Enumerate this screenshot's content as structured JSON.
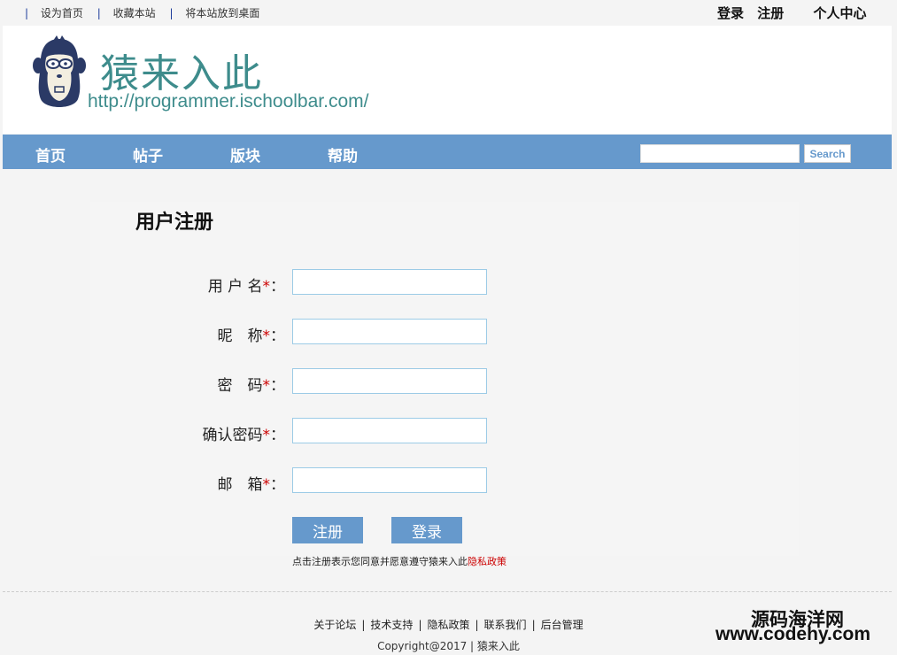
{
  "topbar": {
    "sep": "|",
    "links": [
      "设为首页",
      "收藏本站",
      "将本站放到桌面"
    ],
    "login": "登录",
    "register": "注册",
    "user_center": "个人中心"
  },
  "header": {
    "title": "猿来入此",
    "url": "http://programmer.ischoolbar.com/"
  },
  "nav": {
    "items": [
      "首页",
      "帖子",
      "版块",
      "帮助"
    ],
    "search_value": "",
    "search_button": "Search"
  },
  "form": {
    "title": "用户注册",
    "fields": [
      {
        "label": "用 户 名",
        "star": "*",
        "colon": "：",
        "value": ""
      },
      {
        "label": "昵　称",
        "star": "*",
        "colon": "：",
        "value": ""
      },
      {
        "label": "密　码",
        "star": "*",
        "colon": "：",
        "value": ""
      },
      {
        "label": "确认密码",
        "star": "*",
        "colon": "：",
        "value": ""
      },
      {
        "label": "邮　箱",
        "star": "*",
        "colon": "：",
        "value": ""
      }
    ],
    "register_button": "注册",
    "login_button": "登录",
    "agreement_text": "点击注册表示您同意并愿意遵守猿来入此",
    "agreement_policy": "隐私政策"
  },
  "footer": {
    "links": [
      "关于论坛",
      "技术支持",
      "隐私政策",
      "联系我们",
      "后台管理"
    ],
    "sep": "|",
    "copyright": "Copyright@2017 | 猿来入此"
  },
  "watermark": {
    "line1": "源码海洋网",
    "line2": "www.codehy.com"
  },
  "colors": {
    "nav_bg": "#6699cc",
    "brand_teal": "#3e8c8c",
    "required_red": "#cc0000",
    "input_border": "#9ccbe6"
  }
}
